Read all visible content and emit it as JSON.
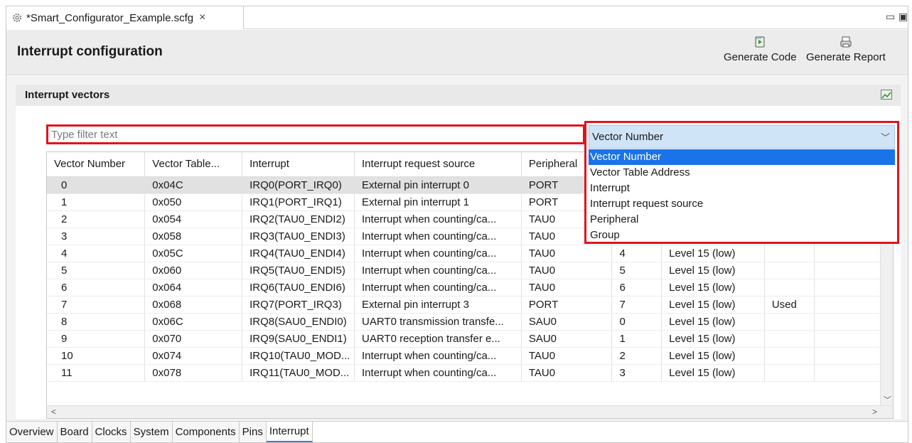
{
  "editor_tab": {
    "title": "*Smart_Configurator_Example.scfg",
    "close_glyph": "×"
  },
  "window_controls": {
    "minimize": "▭",
    "maximize": "▣"
  },
  "header": {
    "title": "Interrupt configuration",
    "buttons": [
      {
        "label": "Generate Code",
        "icon": "generate-code-icon"
      },
      {
        "label": "Generate Report",
        "icon": "generate-report-icon"
      }
    ]
  },
  "section": {
    "title": "Interrupt vectors",
    "icon": "chart-icon"
  },
  "filter": {
    "placeholder": "Type filter text",
    "value": ""
  },
  "column_select": {
    "selected": "Vector Number",
    "options": [
      "Vector Number",
      "Vector Table Address",
      "Interrupt",
      "Interrupt request source",
      "Peripheral",
      "Group"
    ],
    "active_index": 0
  },
  "table": {
    "headers": [
      "Vector Number",
      "Vector Table...",
      "Interrupt",
      "Interrupt request source",
      "Peripheral",
      "",
      "",
      ""
    ],
    "rows": [
      [
        "0",
        "0x04C",
        "IRQ0(PORT_IRQ0)",
        "External pin interrupt 0",
        "PORT",
        "",
        "",
        ""
      ],
      [
        "1",
        "0x050",
        "IRQ1(PORT_IRQ1)",
        "External pin interrupt 1",
        "PORT",
        "",
        "",
        ""
      ],
      [
        "2",
        "0x054",
        "IRQ2(TAU0_ENDI2)",
        "Interrupt when counting/ca...",
        "TAU0",
        "",
        "",
        ""
      ],
      [
        "3",
        "0x058",
        "IRQ3(TAU0_ENDI3)",
        "Interrupt when counting/ca...",
        "TAU0",
        "",
        "",
        ""
      ],
      [
        "4",
        "0x05C",
        "IRQ4(TAU0_ENDI4)",
        "Interrupt when counting/ca...",
        "TAU0",
        "4",
        "Level 15 (low)",
        ""
      ],
      [
        "5",
        "0x060",
        "IRQ5(TAU0_ENDI5)",
        "Interrupt when counting/ca...",
        "TAU0",
        "5",
        "Level 15 (low)",
        ""
      ],
      [
        "6",
        "0x064",
        "IRQ6(TAU0_ENDI6)",
        "Interrupt when counting/ca...",
        "TAU0",
        "6",
        "Level 15 (low)",
        ""
      ],
      [
        "7",
        "0x068",
        "IRQ7(PORT_IRQ3)",
        "External pin interrupt 3",
        "PORT",
        "7",
        "Level 15 (low)",
        "Used"
      ],
      [
        "8",
        "0x06C",
        "IRQ8(SAU0_ENDI0)",
        "UART0 transmission transfe...",
        "SAU0",
        "0",
        "Level 15 (low)",
        ""
      ],
      [
        "9",
        "0x070",
        "IRQ9(SAU0_ENDI1)",
        "UART0 reception transfer e...",
        "SAU0",
        "1",
        "Level 15 (low)",
        ""
      ],
      [
        "10",
        "0x074",
        "IRQ10(TAU0_MOD...",
        "Interrupt when counting/ca...",
        "TAU0",
        "2",
        "Level 15 (low)",
        ""
      ],
      [
        "11",
        "0x078",
        "IRQ11(TAU0_MOD...",
        "Interrupt when counting/ca...",
        "TAU0",
        "3",
        "Level 15 (low)",
        ""
      ]
    ],
    "selected_row": 0
  },
  "bottom_tabs": [
    "Overview",
    "Board",
    "Clocks",
    "System",
    "Components",
    "Pins",
    "Interrupt"
  ],
  "active_bottom_tab": "Interrupt",
  "colors": {
    "highlight_red": "#e0141c",
    "selection_blue": "#1a73e8",
    "select_bg": "#cfe4f7"
  }
}
